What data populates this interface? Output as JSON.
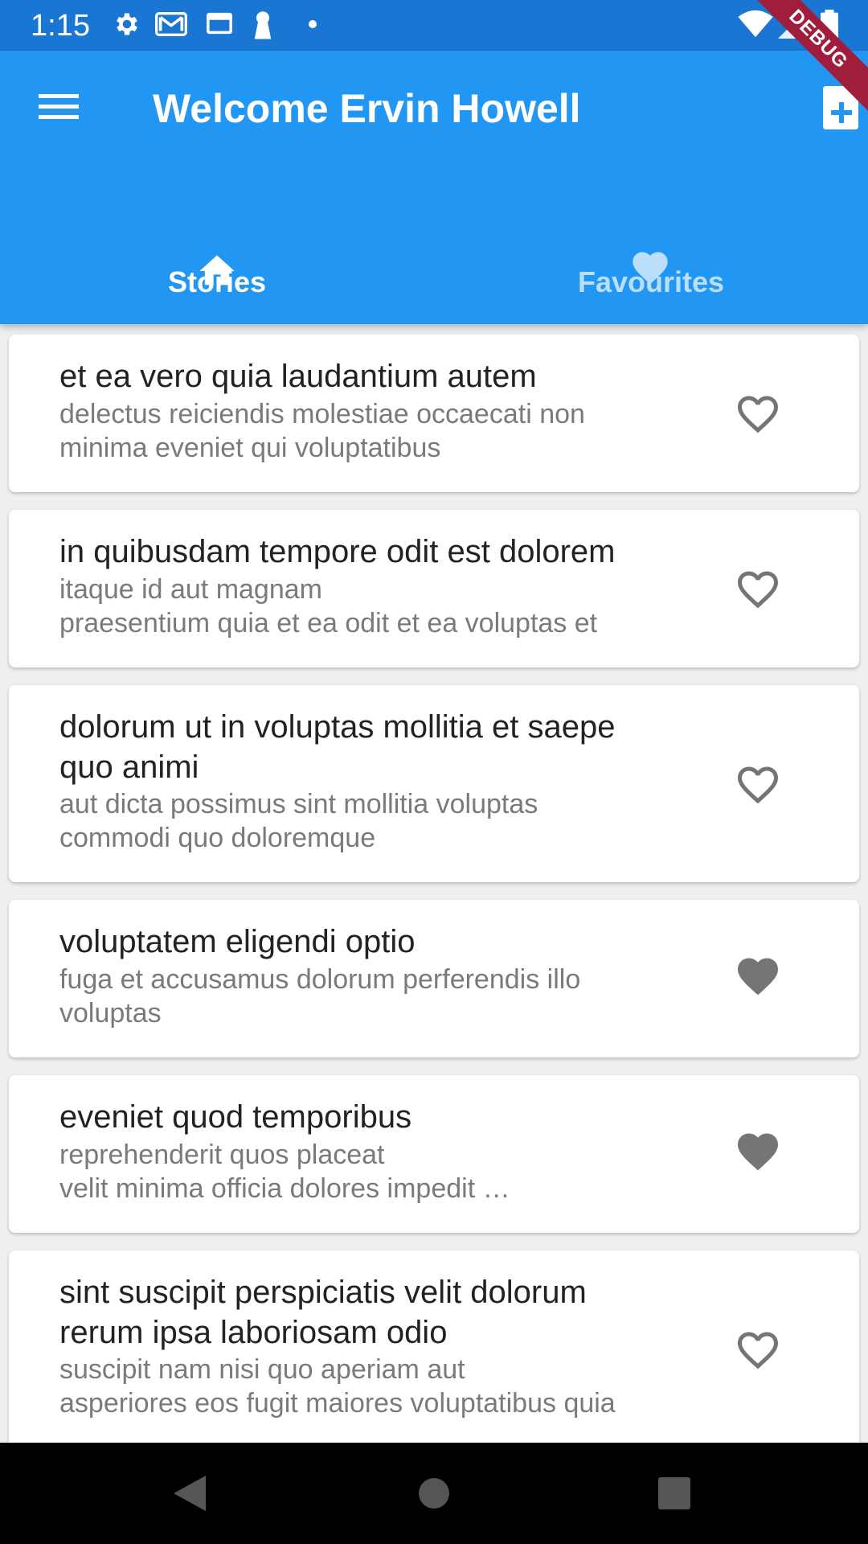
{
  "status_bar": {
    "time": "1:15"
  },
  "app_bar": {
    "title": "Welcome Ervin Howell",
    "tabs": [
      {
        "label": "Stories",
        "icon": "home-icon",
        "selected": true
      },
      {
        "label": "Favourites",
        "icon": "heart-icon",
        "selected": false
      }
    ]
  },
  "debug_banner": "DEBUG",
  "stories": [
    {
      "title": "et ea vero quia laudantium autem",
      "body": "delectus reiciendis molestiae occaecati non\nminima eveniet qui voluptatibus",
      "favourite": false
    },
    {
      "title": "in quibusdam tempore odit est dolorem",
      "body": "itaque id aut magnam\npraesentium quia et ea odit et ea voluptas et",
      "favourite": false
    },
    {
      "title": "dolorum ut in voluptas mollitia et saepe quo animi",
      "body": "aut dicta possimus sint mollitia voluptas\ncommodi quo doloremque",
      "favourite": false
    },
    {
      "title": "voluptatem eligendi optio",
      "body": "fuga et accusamus dolorum perferendis illo\nvoluptas",
      "favourite": true
    },
    {
      "title": "eveniet quod temporibus",
      "body": "reprehenderit quos placeat\nvelit minima officia dolores impedit …",
      "favourite": true
    },
    {
      "title": "sint suscipit perspiciatis velit dolorum rerum ipsa laboriosam odio",
      "body": "suscipit nam nisi quo aperiam aut\nasperiores eos fugit maiores voluptatibus quia",
      "favourite": false
    }
  ],
  "colors": {
    "app_bar": "#2196f3",
    "status_bar": "#1976d2",
    "selected_tab": "#ffffff",
    "unselected_tab": "#bbdefb",
    "heart": "#757575"
  }
}
